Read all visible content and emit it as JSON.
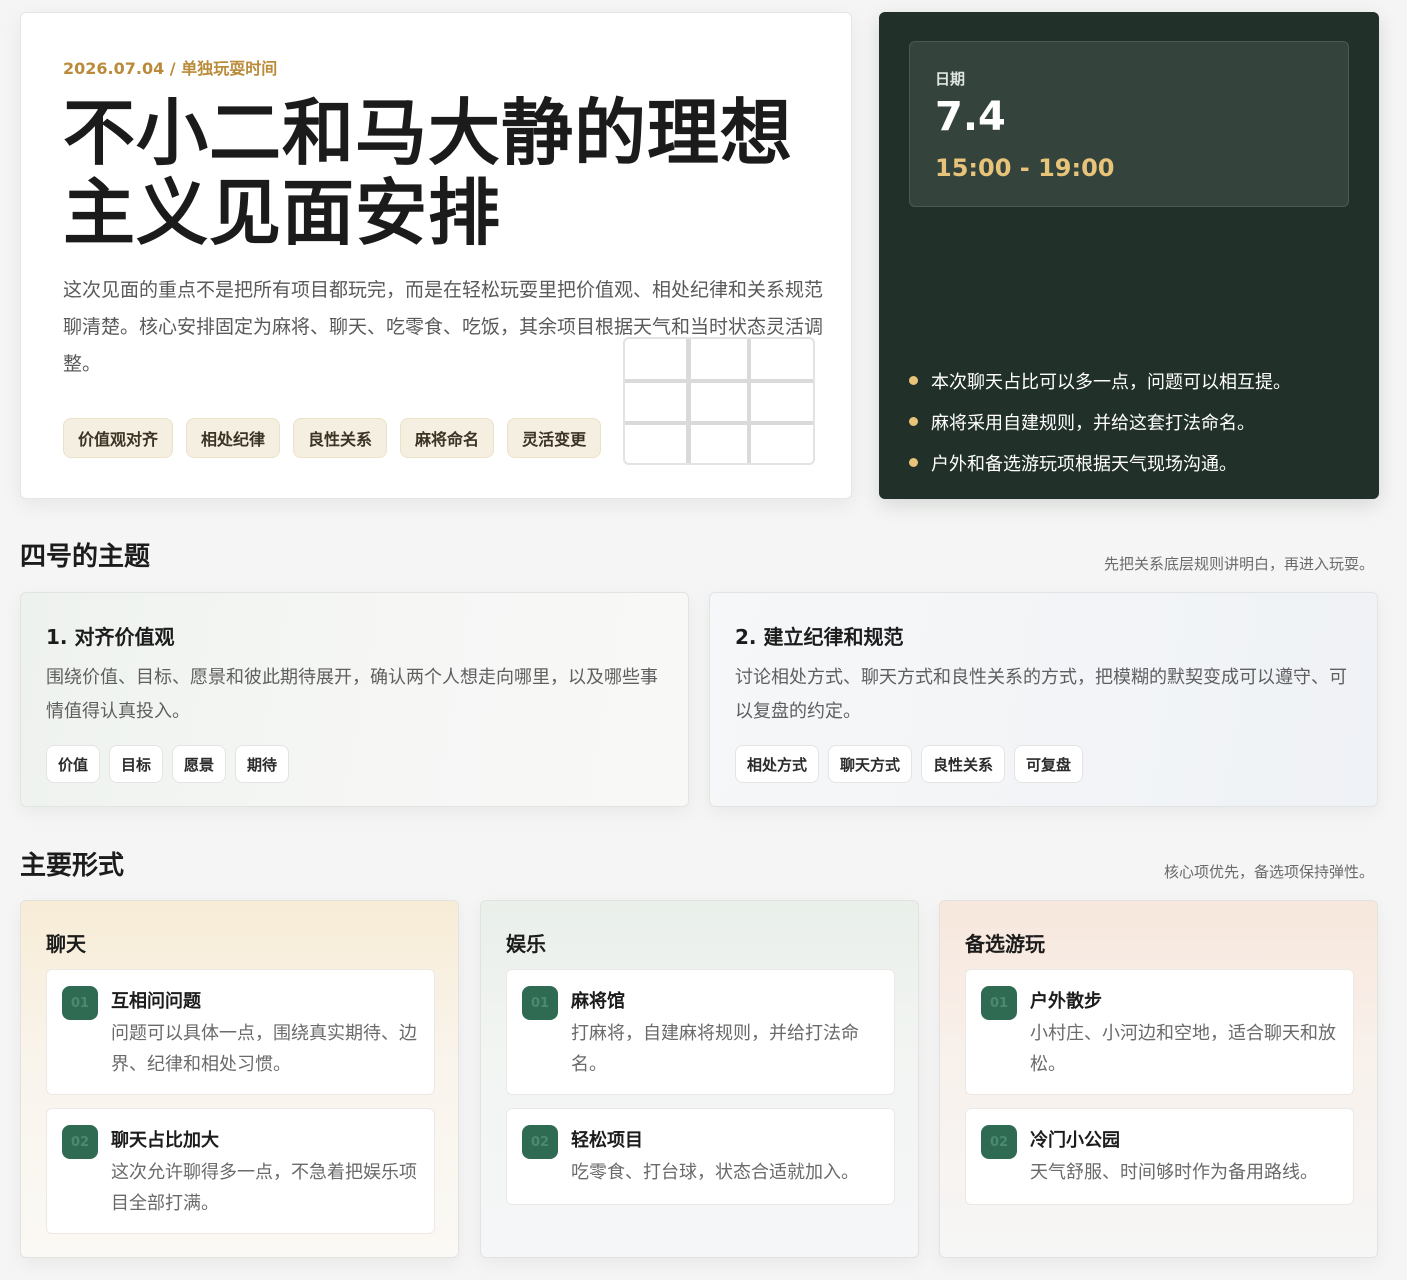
{
  "hero": {
    "eyebrow": "2026.07.04 / 单独玩耍时间",
    "title": "不小二和马大静的理想主义见面安排",
    "description": "这次见面的重点不是把所有项目都玩完，而是在轻松玩耍里把价值观、相处纪律和关系规范聊清楚。核心安排固定为麻将、聊天、吃零食、吃饭，其余项目根据天气和当时状态灵活调整。",
    "tags": [
      "价值观对齐",
      "相处纪律",
      "良性关系",
      "麻将命名",
      "灵活变更"
    ]
  },
  "schedule": {
    "date_label": "日期",
    "date": "7.4",
    "time": "15:00 - 19:00",
    "notes": [
      "本次聊天占比可以多一点，问题可以相互提。",
      "麻将采用自建规则，并给这套打法命名。",
      "户外和备选游玩项根据天气现场沟通。"
    ]
  },
  "themes": {
    "heading": "四号的主题",
    "subheading": "先把关系底层规则讲明白，再进入玩耍。",
    "cards": [
      {
        "title": "1. 对齐价值观",
        "desc": "围绕价值、目标、愿景和彼此期待展开，确认两个人想走向哪里，以及哪些事情值得认真投入。",
        "tags": [
          "价值",
          "目标",
          "愿景",
          "期待"
        ]
      },
      {
        "title": "2. 建立纪律和规范",
        "desc": "讨论相处方式、聊天方式和良性关系的方式，把模糊的默契变成可以遵守、可以复盘的约定。",
        "tags": [
          "相处方式",
          "聊天方式",
          "良性关系",
          "可复盘"
        ]
      }
    ]
  },
  "forms": {
    "heading": "主要形式",
    "subheading": "核心项优先，备选项保持弹性。",
    "columns": [
      {
        "title": "聊天",
        "items": [
          {
            "num": "01",
            "title": "互相问问题",
            "desc": "问题可以具体一点，围绕真实期待、边界、纪律和相处习惯。"
          },
          {
            "num": "02",
            "title": "聊天占比加大",
            "desc": "这次允许聊得多一点，不急着把娱乐项目全部打满。"
          }
        ]
      },
      {
        "title": "娱乐",
        "items": [
          {
            "num": "01",
            "title": "麻将馆",
            "desc": "打麻将，自建麻将规则，并给打法命名。"
          },
          {
            "num": "02",
            "title": "轻松项目",
            "desc": "吃零食、打台球，状态合适就加入。"
          }
        ]
      },
      {
        "title": "备选游玩",
        "items": [
          {
            "num": "01",
            "title": "户外散步",
            "desc": "小村庄、小河边和空地，适合聊天和放松。"
          },
          {
            "num": "02",
            "title": "冷门小公园",
            "desc": "天气舒服、时间够时作为备用路线。"
          }
        ]
      }
    ]
  },
  "colors": {
    "accent_gold": "#b98b3a",
    "dark_panel": "#213029",
    "badge_green": "#2f6b52",
    "time_yellow": "#e7c47a"
  }
}
